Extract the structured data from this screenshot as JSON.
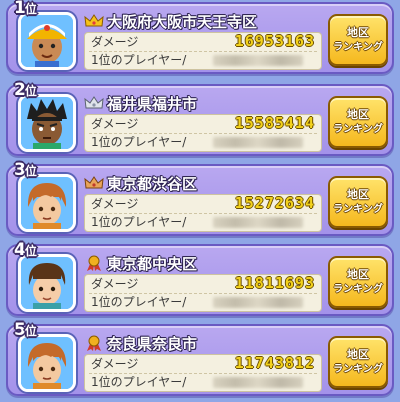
{
  "rankings": [
    {
      "rank": "1",
      "rank_suffix": "位",
      "badge": "gold-crown-icon",
      "area": "大阪府大阪市天王寺区",
      "damage_label": "ダメージ",
      "damage_value": "16953163",
      "top_player_label": "1位のプレイヤー/",
      "button_line1": "地区",
      "button_line2": "ランキング"
    },
    {
      "rank": "2",
      "rank_suffix": "位",
      "badge": "silver-crown-icon",
      "area": "福井県福井市",
      "damage_label": "ダメージ",
      "damage_value": "15585414",
      "top_player_label": "1位のプレイヤー/",
      "button_line1": "地区",
      "button_line2": "ランキング"
    },
    {
      "rank": "3",
      "rank_suffix": "位",
      "badge": "bronze-crown-icon",
      "area": "東京都渋谷区",
      "damage_label": "ダメージ",
      "damage_value": "15272634",
      "top_player_label": "1位のプレイヤー/",
      "button_line1": "地区",
      "button_line2": "ランキング"
    },
    {
      "rank": "4",
      "rank_suffix": "位",
      "badge": "ribbon-medal-icon",
      "area": "東京都中央区",
      "damage_label": "ダメージ",
      "damage_value": "11811693",
      "top_player_label": "1位のプレイヤー/",
      "button_line1": "地区",
      "button_line2": "ランキング"
    },
    {
      "rank": "5",
      "rank_suffix": "位",
      "badge": "ribbon-medal-icon",
      "area": "奈良県奈良市",
      "damage_label": "ダメージ",
      "damage_value": "11743812",
      "top_player_label": "1位のプレイヤー/",
      "button_line1": "地区",
      "button_line2": "ランキング"
    }
  ],
  "colors": {
    "background": "#8fa6e6",
    "card": "#ad9cec",
    "damage_value": "#f3d21c",
    "button": "#f5b81e"
  }
}
